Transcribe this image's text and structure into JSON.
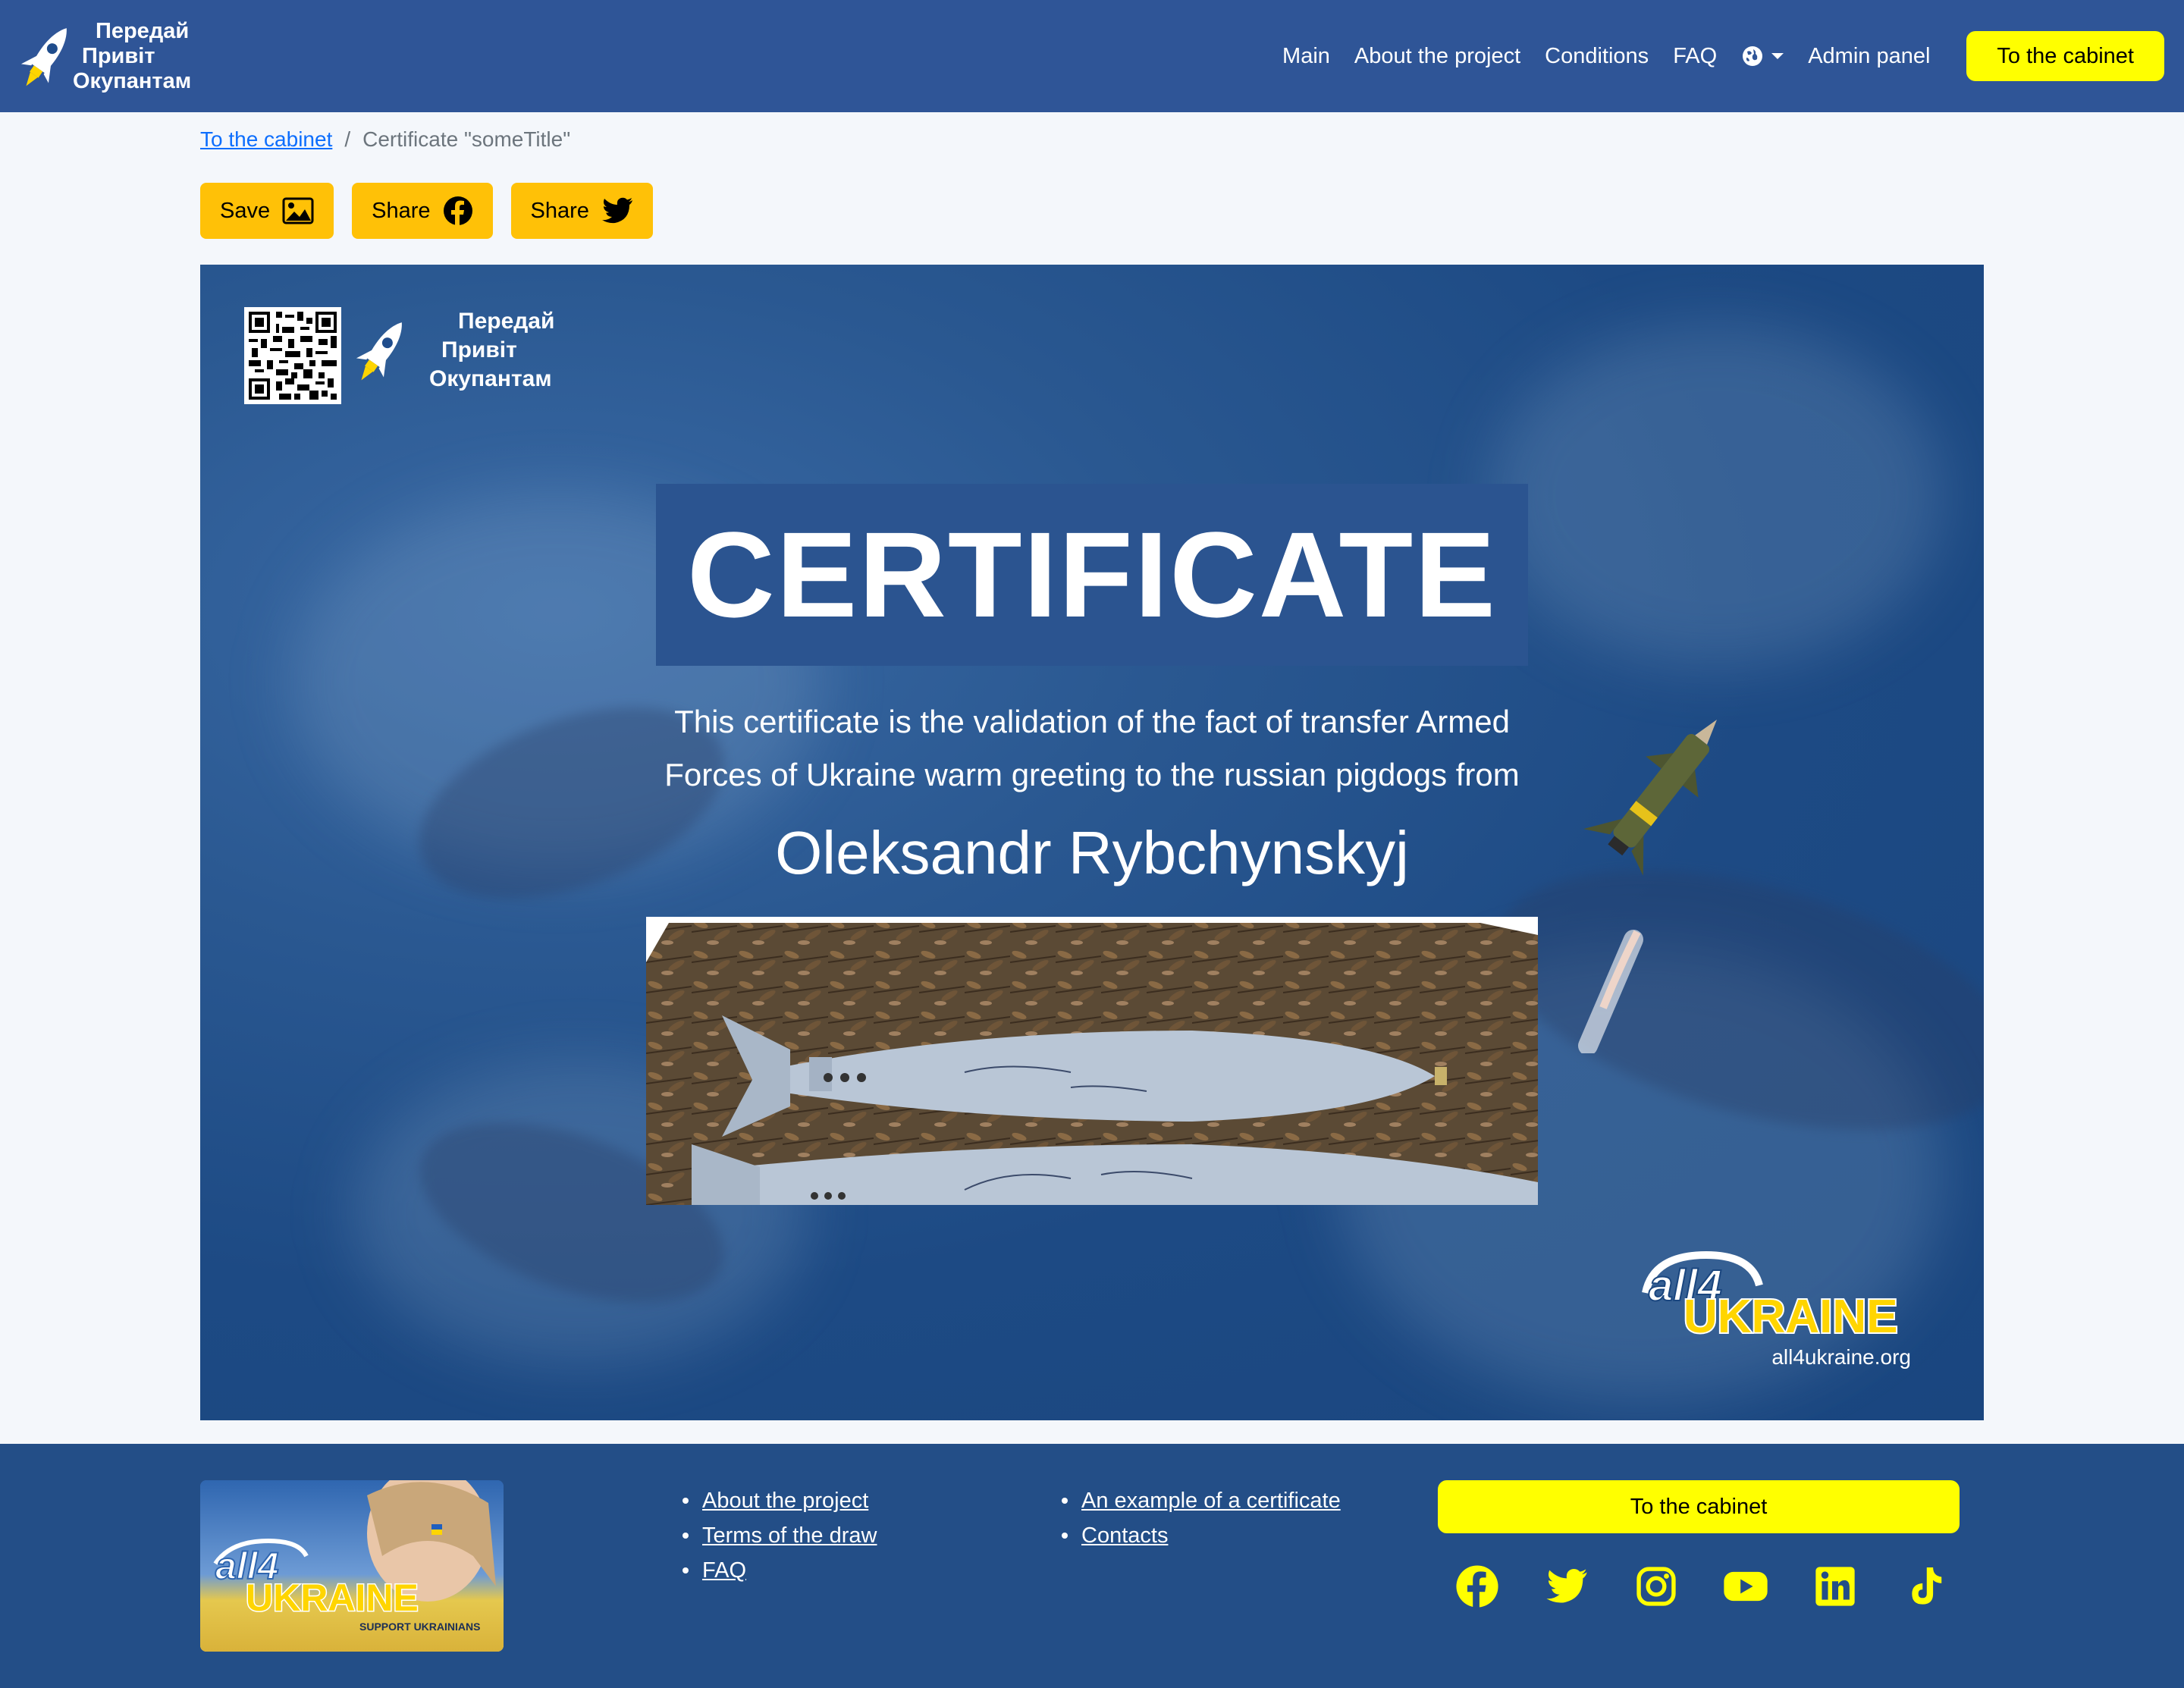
{
  "header": {
    "brand_lines": [
      "Передай",
      "Привіт",
      "Окупантам"
    ],
    "nav": [
      "Main",
      "About the project",
      "Conditions",
      "FAQ"
    ],
    "admin_label": "Admin panel",
    "cabinet_label": "To the cabinet"
  },
  "breadcrumb": {
    "link": "To the cabinet",
    "separator": "/",
    "current": "Certificate \"someTitle\""
  },
  "actions": {
    "save_label": "Save",
    "share_facebook_label": "Share",
    "share_twitter_label": "Share"
  },
  "certificate": {
    "brand_lines": [
      "Передай",
      "Привіт",
      "Окупантам"
    ],
    "title": "CERTIFICATE",
    "description_line1": "This certificate is the validation of the fact of transfer Armed",
    "description_line2": "Forces of Ukraine warm greeting to the russian pigdogs from",
    "name": "Oleksandr Rybchynskyj",
    "partner_word1": "all4",
    "partner_word2": "UKRAINE",
    "partner_url": "all4ukraine.org"
  },
  "footer": {
    "image_text1": "all4",
    "image_text2": "UKRAINE",
    "image_text3": "SUPPORT UKRAINIANS",
    "col1": [
      "About the project",
      "Terms of the draw",
      "FAQ"
    ],
    "col2": [
      "An example of a certificate",
      "Contacts"
    ],
    "cabinet_label": "To the cabinet",
    "socials": [
      "facebook-icon",
      "twitter-icon",
      "instagram-icon",
      "youtube-icon",
      "linkedin-icon",
      "tiktok-icon"
    ]
  },
  "colors": {
    "header_bg": "#2f5597",
    "accent_yellow": "#ffff00",
    "button_amber": "#ffc107",
    "footer_bg": "#234e87",
    "cert_bg": "#1d4a84"
  }
}
